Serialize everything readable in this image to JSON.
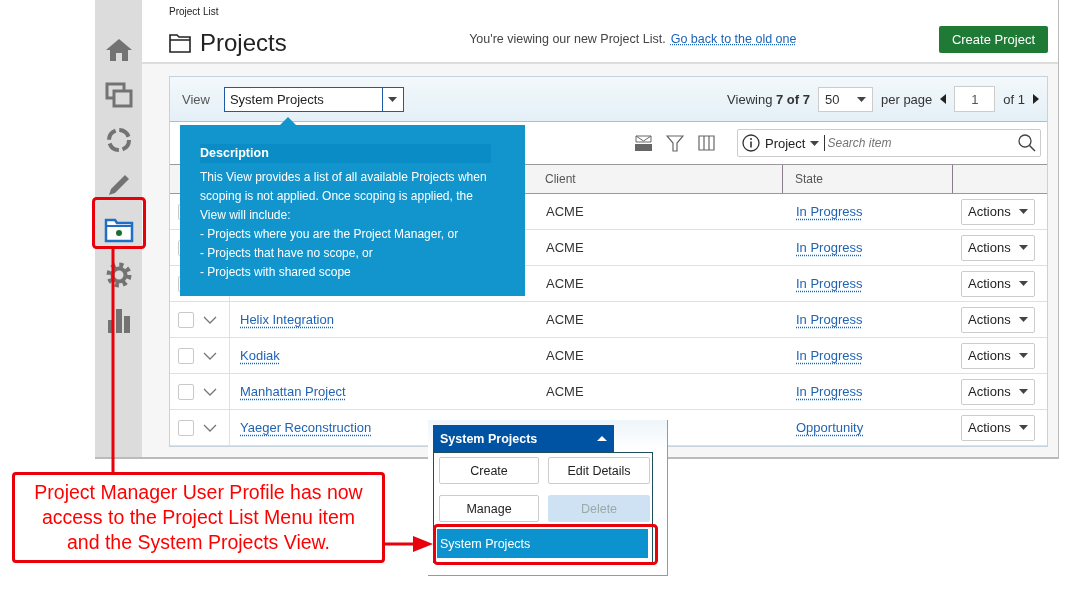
{
  "sidebar": {
    "items": [
      {
        "kind": "home",
        "selected": false
      },
      {
        "kind": "windows",
        "selected": false
      },
      {
        "kind": "ring",
        "selected": false
      },
      {
        "kind": "pencil",
        "selected": false
      },
      {
        "kind": "folder",
        "selected": true
      },
      {
        "kind": "gear",
        "selected": false
      },
      {
        "kind": "chart",
        "selected": false
      }
    ]
  },
  "header": {
    "breadcrumb": "Project List",
    "title": "Projects",
    "notice": "You're viewing our new Project List.",
    "notice_link": "Go back to the old one",
    "create_button": "Create Project"
  },
  "view_bar": {
    "label": "View",
    "view_select": "System Projects",
    "viewing": "Viewing **7 of 7**",
    "per_page": "50",
    "per_page_label": "per page",
    "page": "1",
    "page_count": "of 1"
  },
  "toolbar": {
    "search_scope": "Project",
    "search_placeholder": "Search item"
  },
  "table": {
    "columns": [
      "Client",
      "State"
    ],
    "rows": [
      {
        "checked": false,
        "client": "ACME",
        "state": "In Progress",
        "action": "Actions"
      },
      {
        "checked": false,
        "client": "ACME",
        "state": "In Progress",
        "action": "Actions"
      },
      {
        "checked": false,
        "client": "ACME",
        "state": "In Progress",
        "action": "Actions"
      },
      {
        "checked": false,
        "name": "Helix Integration",
        "client": "ACME",
        "state": "In Progress",
        "action": "Actions"
      },
      {
        "checked": false,
        "name": "Kodiak",
        "client": "ACME",
        "state": "In Progress",
        "action": "Actions"
      },
      {
        "checked": false,
        "name": "Manhattan Project",
        "client": "ACME",
        "state": "In Progress",
        "action": "Actions"
      },
      {
        "checked": false,
        "name": "Yaeger Reconstruction",
        "state": "Opportunity",
        "action": "Actions"
      }
    ]
  },
  "description_tooltip": {
    "title": "Description",
    "text": "This View provides a list of all available Projects when scoping is not applied. Once scoping is applied, the View will include:",
    "bullets": [
      "- Projects where you are the Project Manager, or",
      "- Projects that have no scope, or",
      "- Projects with shared scope"
    ]
  },
  "view_menu": {
    "current": "System Projects",
    "buttons": [
      {
        "label": "Create",
        "disabled": false
      },
      {
        "label": "Edit Details",
        "disabled": false
      },
      {
        "label": "Manage",
        "disabled": false
      },
      {
        "label": "Delete",
        "disabled": true
      }
    ],
    "views": [
      {
        "label": "System Projects",
        "selected": true
      }
    ]
  },
  "callout": {
    "text": "Project Manager User Profile has now access to the Project List Menu item and the System Projects View."
  }
}
